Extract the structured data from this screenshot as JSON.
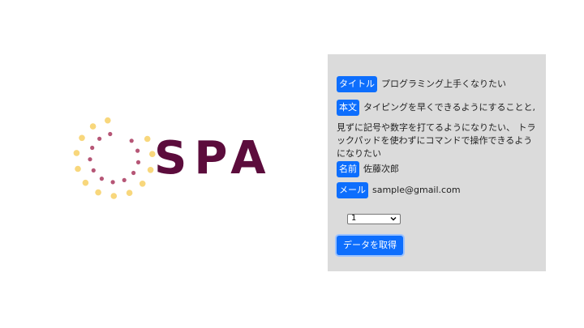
{
  "logo": {
    "text": "SPA",
    "text_color": "#5c0c3c",
    "dot_outer_color": "#f8d77c",
    "dot_inner_color": "#b65676"
  },
  "accent_color": "#0d6efd",
  "panel_bg": "#dbdbdb",
  "form": {
    "title_label": "タイトル",
    "title_value": "プログラミング上手くなりたい",
    "body_label": "本文",
    "body_first_line": "タイピングを早くできるようにすることと,",
    "body_continuation": "見ずに記号や数字を打てるようになりたい、 トラックパッドを使わずにコマンドで操作できるようになりたい",
    "name_label": "名前",
    "name_value": "佐藤次郎",
    "email_label": "メール",
    "email_value": "sample@gmail.com",
    "select_value": "1",
    "select_icon": "chevron-down-icon",
    "fetch_button_label": "データを取得"
  }
}
